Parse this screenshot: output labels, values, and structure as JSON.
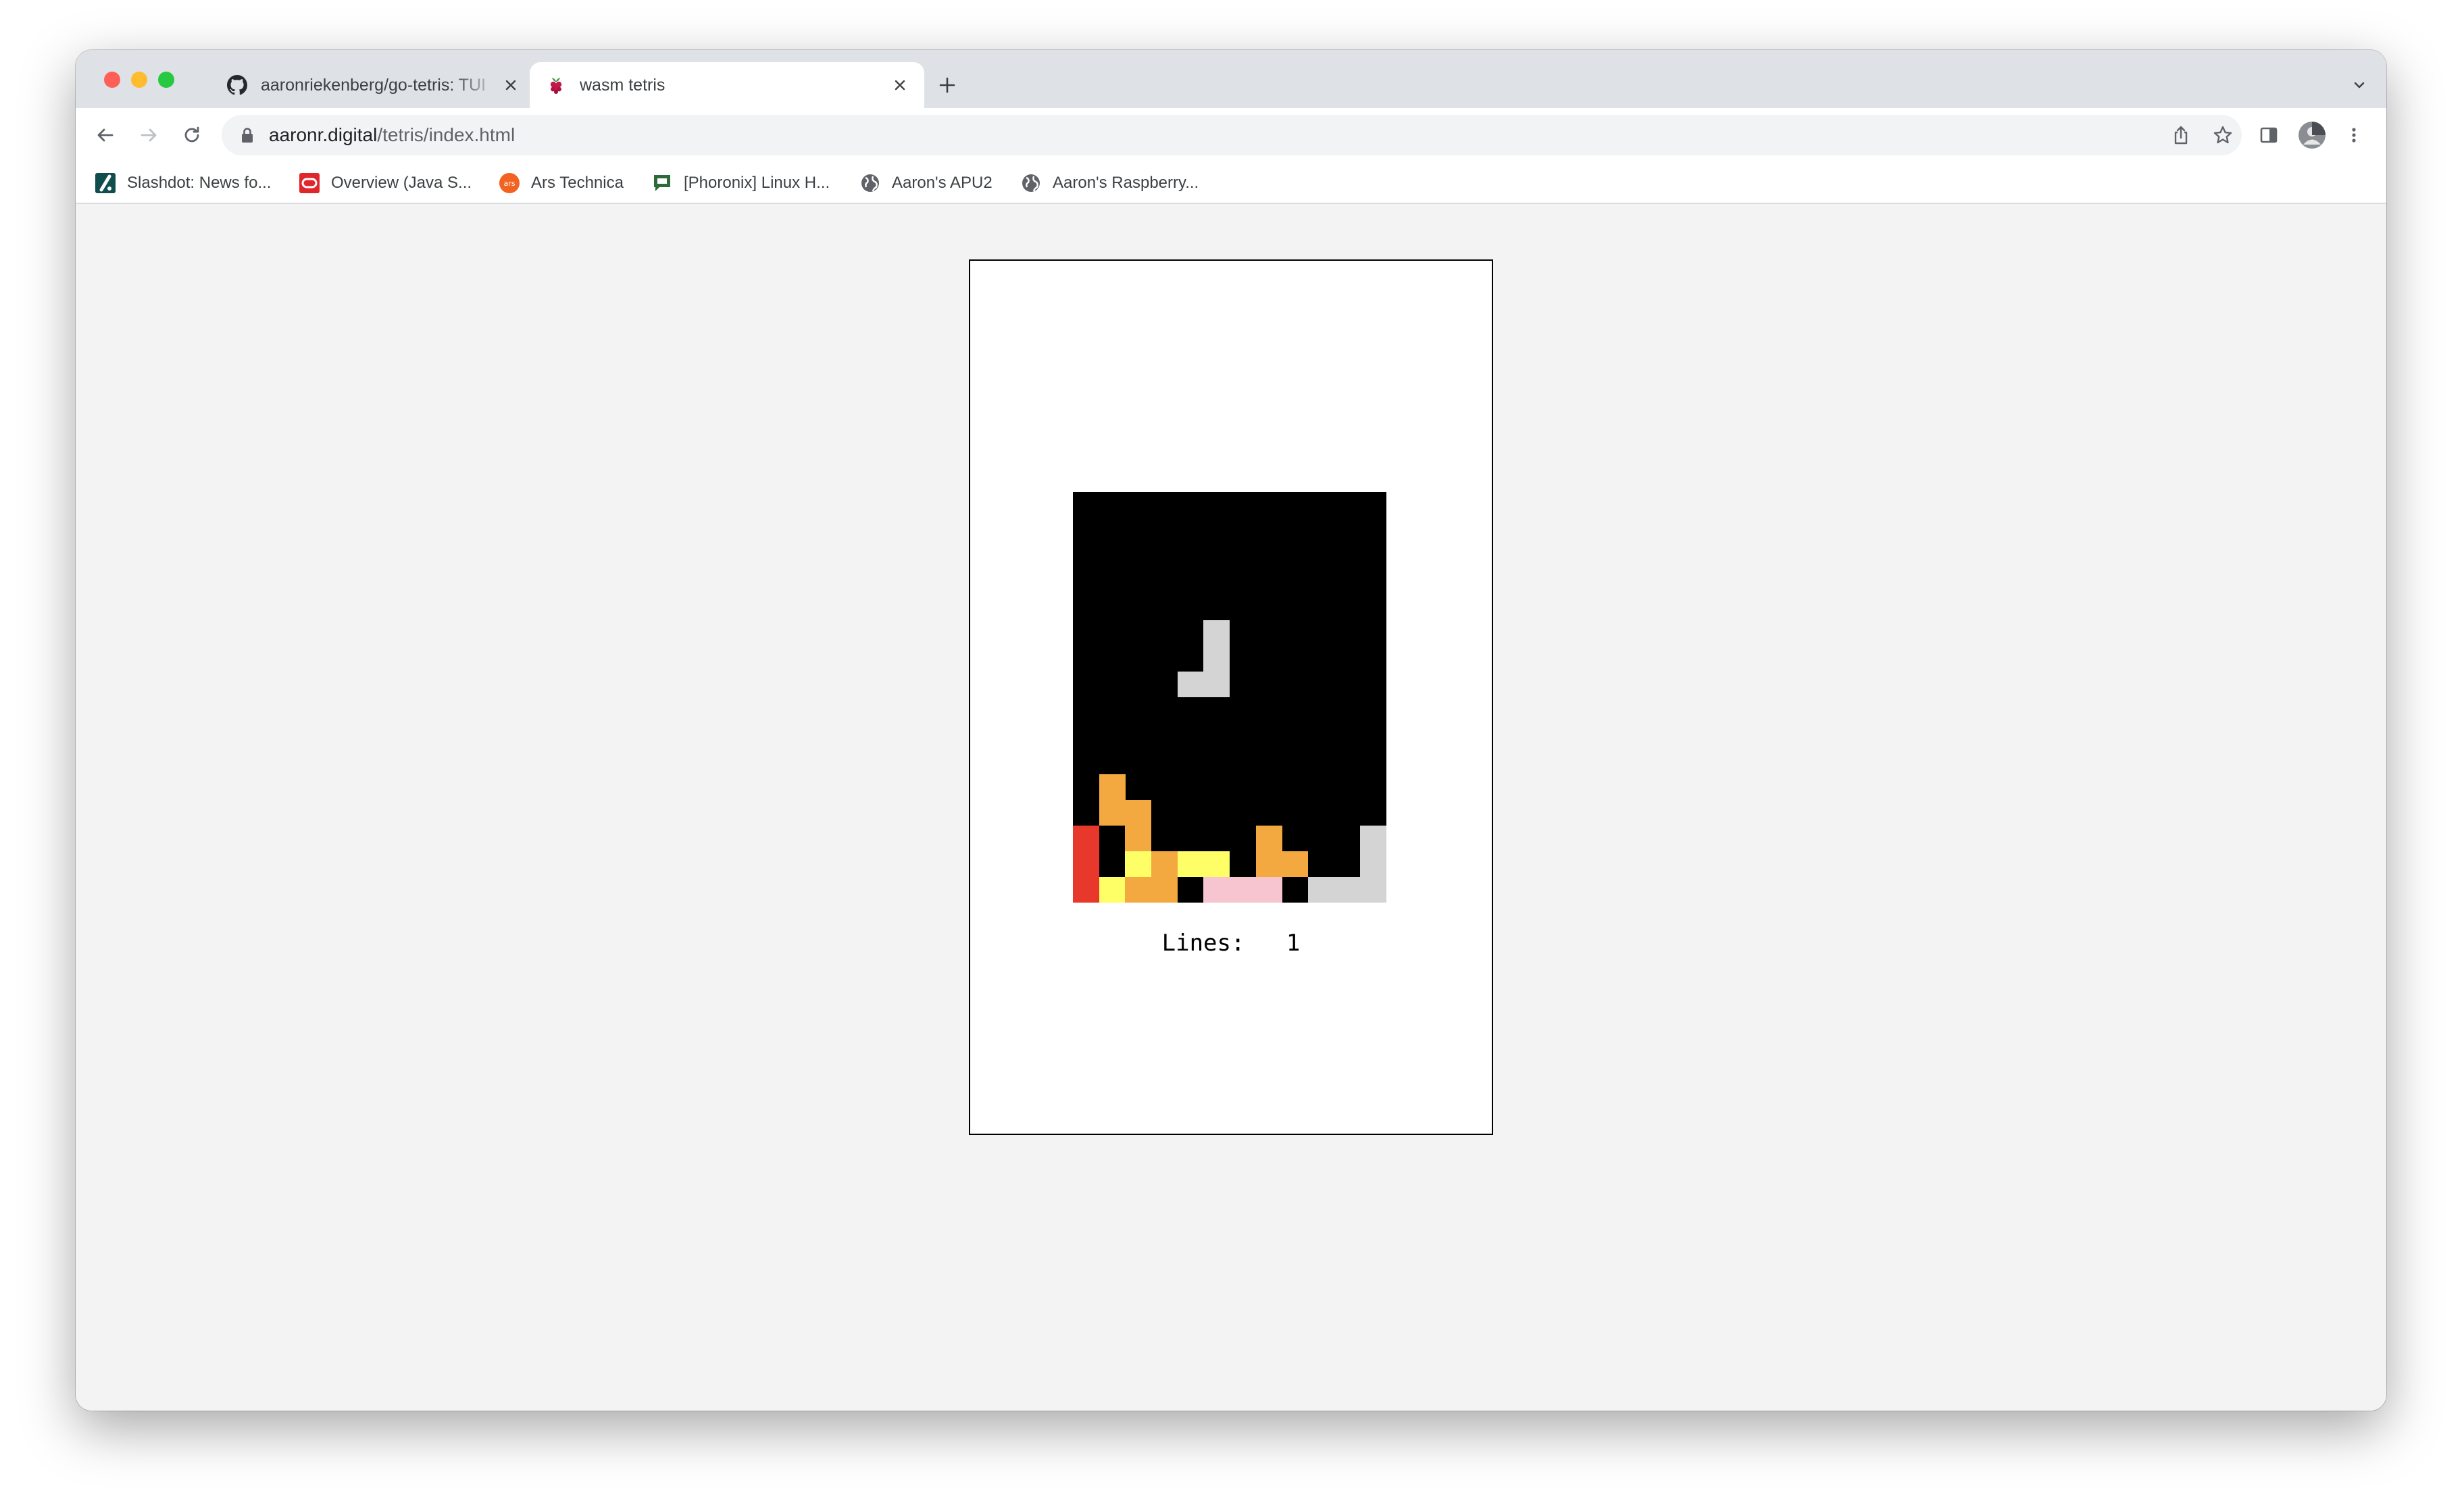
{
  "tabs": [
    {
      "title": "aaronriekenberg/go-tetris: TUI",
      "favicon": "github-icon",
      "active": false
    },
    {
      "title": "wasm tetris",
      "favicon": "raspberry-icon",
      "active": true
    }
  ],
  "address_bar": {
    "host": "aaronr.digital",
    "path": "/tetris/index.html"
  },
  "bookmarks": [
    {
      "label": "Slashdot: News fo...",
      "icon": "slashdot-icon"
    },
    {
      "label": "Overview (Java S...",
      "icon": "oracle-icon"
    },
    {
      "label": "Ars Technica",
      "icon": "ars-technica-icon"
    },
    {
      "label": "[Phoronix] Linux H...",
      "icon": "phoronix-icon"
    },
    {
      "label": "Aaron's APU2",
      "icon": "globe-icon"
    },
    {
      "label": "Aaron's Raspberry...",
      "icon": "globe-icon"
    }
  ],
  "game": {
    "lines_label": "Lines:",
    "lines_value": "1",
    "board_cols": 12,
    "board_rows": 16,
    "palette": {
      "O": "#f4a940",
      "R": "#e8382c",
      "Y": "#fefe66",
      "P": "#f7c5cf",
      "G": "#d4d4d4"
    },
    "cells": [
      "............",
      "............",
      "............",
      "............",
      "............",
      ".....G......",
      ".....G......",
      "....GG......",
      "............",
      "............",
      "............",
      ".O..........",
      ".OO.........",
      "R.O....O...G",
      "R.YOYY.OO..G",
      "RYOO.PPP.GGG"
    ]
  },
  "colors": {
    "window_bg": "#f3f3f3",
    "tabstrip_bg": "#dee1e6",
    "board_bg": "#000000"
  }
}
